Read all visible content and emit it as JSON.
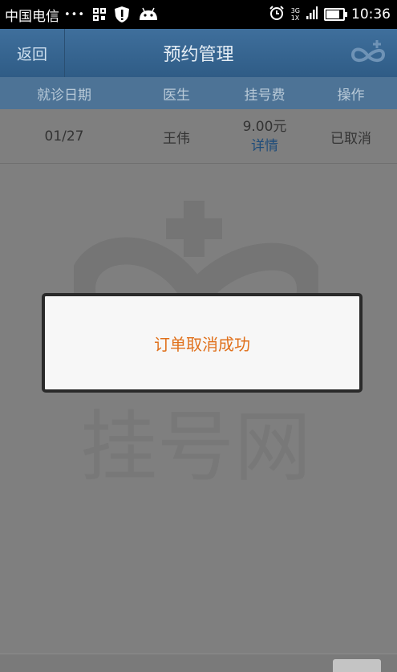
{
  "status_bar": {
    "carrier": "中国电信",
    "dots": "•••",
    "network_label": "3G",
    "network_label2": "1X",
    "time": "10:36",
    "battery_level": 0.9
  },
  "header": {
    "back_label": "返回",
    "title": "预约管理"
  },
  "table": {
    "columns": [
      "就诊日期",
      "医生",
      "挂号费",
      "操作"
    ],
    "rows": [
      {
        "date": "01/27",
        "doctor": "王伟",
        "fee": "9.00元",
        "detail": "详情",
        "action": "已取消"
      }
    ]
  },
  "background_watermark": "挂号网",
  "dialog": {
    "message": "订单取消成功"
  }
}
